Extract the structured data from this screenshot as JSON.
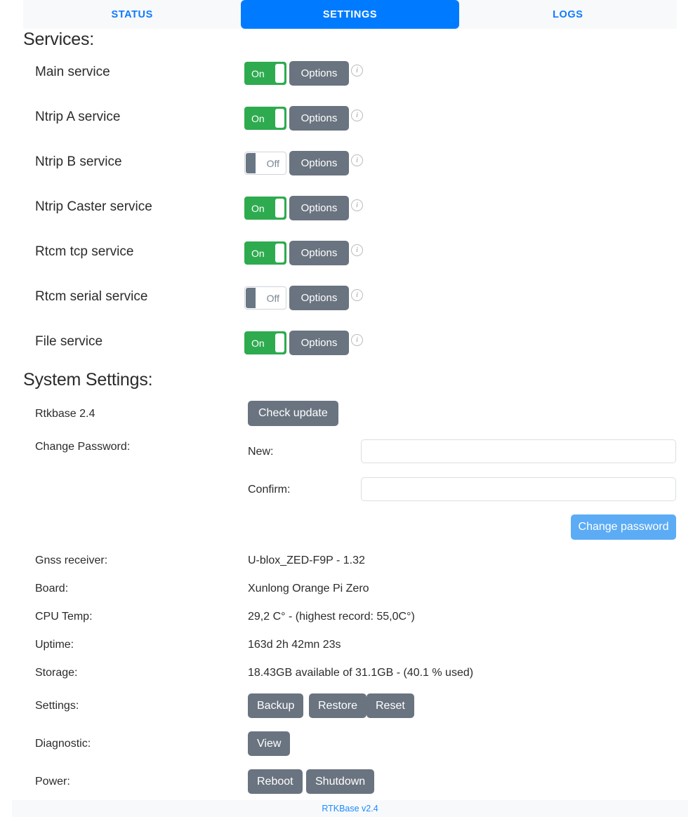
{
  "tabs": [
    {
      "id": "status",
      "label": "STATUS",
      "active": false
    },
    {
      "id": "settings",
      "label": "SETTINGS",
      "active": true
    },
    {
      "id": "logs",
      "label": "LOGS",
      "active": false
    }
  ],
  "sections": {
    "services_title": "Services:",
    "system_title": "System Settings:"
  },
  "services": [
    {
      "name": "Main service",
      "state": "On",
      "options_label": "Options",
      "info_icon": "info-circle-icon"
    },
    {
      "name": "Ntrip A service",
      "state": "On",
      "options_label": "Options",
      "info_icon": "info-circle-icon"
    },
    {
      "name": "Ntrip B service",
      "state": "Off",
      "options_label": "Options",
      "info_icon": "info-circle-icon"
    },
    {
      "name": "Ntrip Caster service",
      "state": "On",
      "options_label": "Options",
      "info_icon": "info-circle-icon"
    },
    {
      "name": "Rtcm tcp service",
      "state": "On",
      "options_label": "Options",
      "info_icon": "info-circle-icon"
    },
    {
      "name": "Rtcm serial service",
      "state": "Off",
      "options_label": "Options",
      "info_icon": "info-circle-icon"
    },
    {
      "name": "File service",
      "state": "On",
      "options_label": "Options",
      "info_icon": "info-circle-icon"
    }
  ],
  "system": {
    "version_label": "Rtkbase 2.4",
    "check_update_label": "Check update",
    "change_password_label": "Change Password:",
    "new_label": "New:",
    "confirm_label": "Confirm:",
    "new_value": "",
    "confirm_value": "",
    "new_placeholder": "",
    "confirm_placeholder": "",
    "change_password_button": "Change password",
    "info_rows": [
      {
        "label": "Gnss receiver:",
        "value": "U-blox_ZED-F9P - 1.32"
      },
      {
        "label": "Board:",
        "value": "Xunlong Orange Pi Zero"
      },
      {
        "label": "CPU Temp:",
        "value": "29,2 C° - (highest record: 55,0C°)"
      },
      {
        "label": "Uptime:",
        "value": "163d 2h 42mn 23s"
      },
      {
        "label": "Storage:",
        "value": "18.43GB available of 31.1GB - (40.1 % used)"
      }
    ],
    "settings_row_label": "Settings:",
    "settings_buttons": [
      "Backup",
      "Restore",
      "Reset"
    ],
    "diagnostic_row_label": "Diagnostic:",
    "diagnostic_buttons": [
      "View"
    ],
    "power_row_label": "Power:",
    "power_buttons": [
      "Reboot",
      "Shutdown"
    ]
  },
  "footer": {
    "text": "RTKBase v2.4"
  },
  "colors": {
    "accent_blue": "#007bff",
    "link_blue": "#1a8cff",
    "toggle_on_green": "#2eab4f",
    "button_gray": "#6a7480",
    "light_blue_button": "#5cacf5",
    "tabbar_bg": "#f8f9fa"
  }
}
